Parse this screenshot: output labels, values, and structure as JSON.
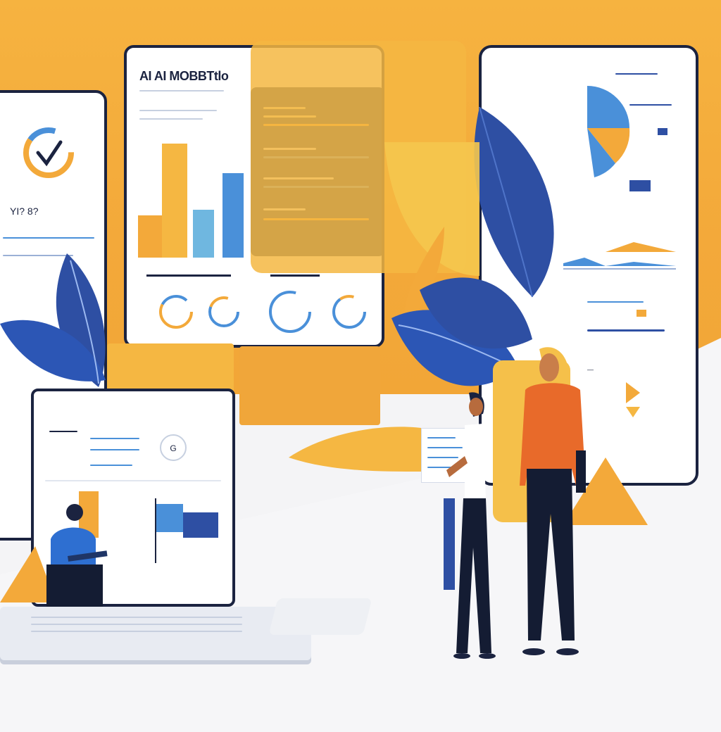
{
  "main_screen": {
    "title": "AI AI MOBBTtlo"
  },
  "left_phone": {
    "label": "YI? 8?"
  },
  "colors": {
    "orange": "#f3a93a",
    "blue": "#2e4fa3",
    "light_blue": "#4a90d9",
    "navy": "#1b2340",
    "white": "#ffffff"
  },
  "icons": [
    "checkmark-icon",
    "gauge-icon",
    "leaf-icon",
    "person-icon",
    "laptop-icon",
    "pie-chart-icon"
  ]
}
